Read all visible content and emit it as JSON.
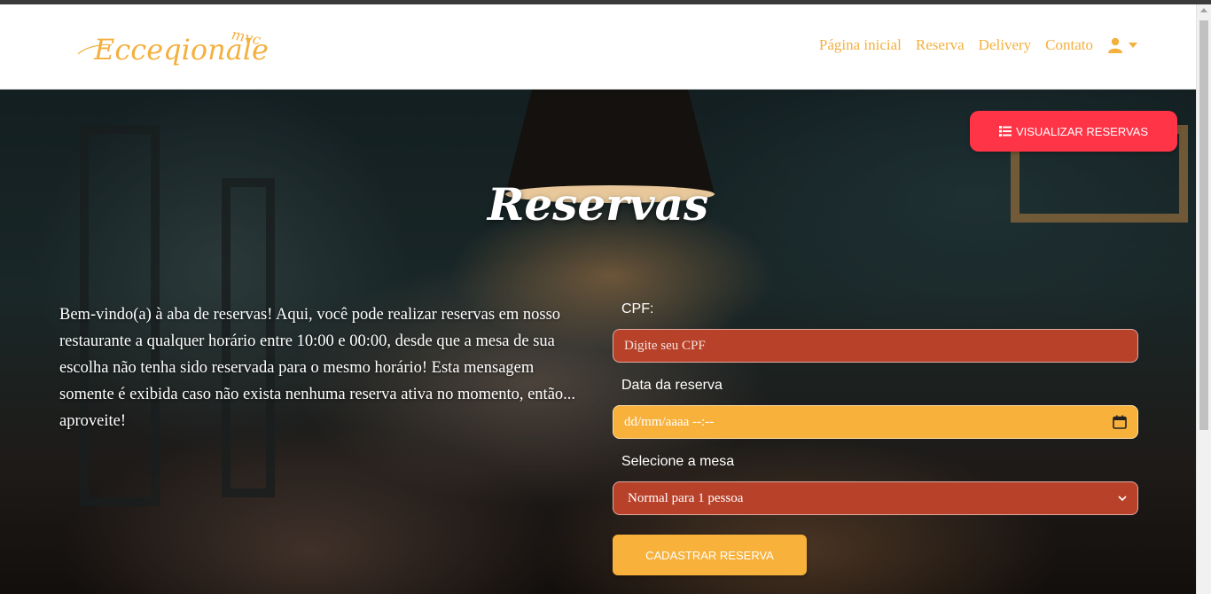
{
  "brand": {
    "logo_text": "Ecceqionale",
    "logo_sup": "mvc",
    "color": "#f4b03f"
  },
  "nav": {
    "links": [
      {
        "label": "Página inicial"
      },
      {
        "label": "Reserva"
      },
      {
        "label": "Delivery"
      },
      {
        "label": "Contato"
      }
    ],
    "user_icon": "user-icon",
    "caret_icon": "caret-down-icon"
  },
  "hero": {
    "view_button_label": "VISUALIZAR RESERVAS",
    "view_button_icon": "list-icon",
    "view_button_color": "#ff3547",
    "title": "Reservas",
    "intro": "Bem-vindo(a) à aba de reservas! Aqui, você pode realizar reservas em nosso restaurante a qualquer horário entre 10:00 e 00:00, desde que a mesa de sua escolha não tenha sido reservada para o mesmo horário! Esta mensagem somente é exibida caso não exista nenhuma reserva ativa no momento, então... aproveite!"
  },
  "form": {
    "cpf_label": "CPF:",
    "cpf_placeholder": "Digite seu CPF",
    "date_label": "Data da reserva",
    "date_placeholder": "dd/mm/aaaa  --:--",
    "table_label": "Selecione a mesa",
    "table_selected": "Normal para 1 pessoa",
    "submit_label": "CADASTRAR RESERVA",
    "colors": {
      "primary": "#b8412a",
      "accent": "#f8b13b"
    }
  }
}
